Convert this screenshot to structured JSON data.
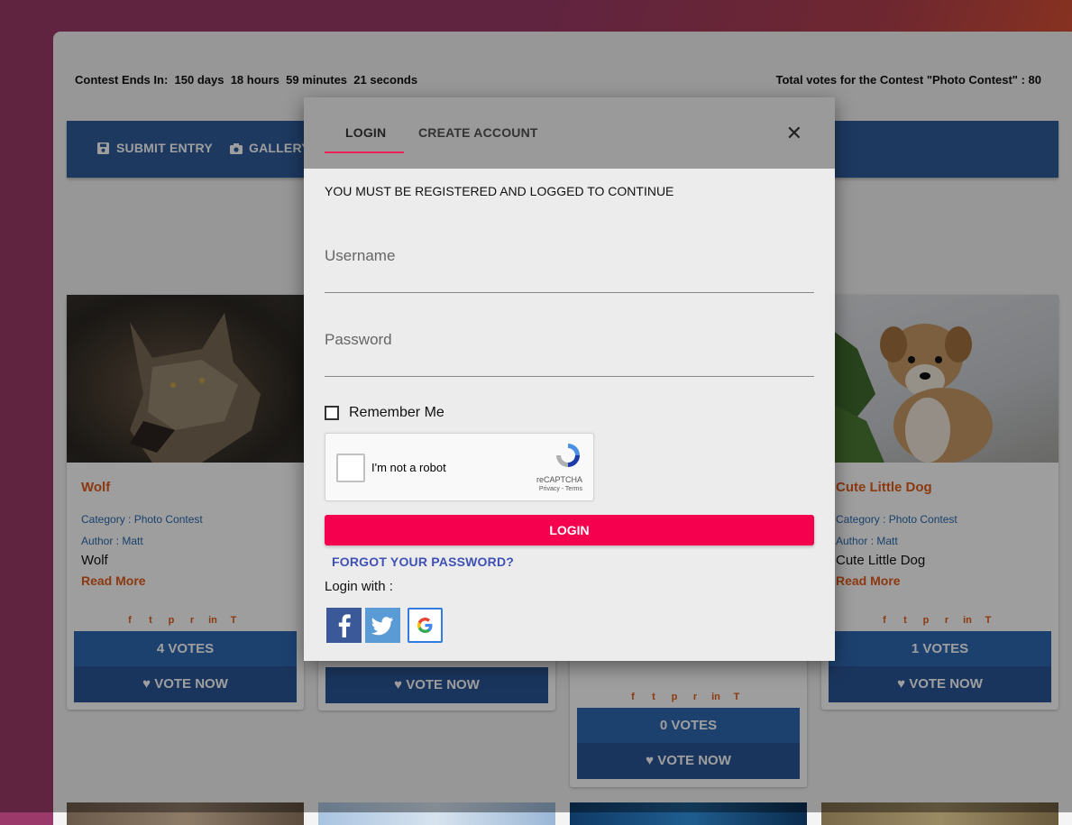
{
  "header": {
    "countdown_label": "Contest Ends In:",
    "days": "150 days",
    "hours": "18 hours",
    "minutes": "59 minutes",
    "seconds": "21 seconds",
    "total_votes": "Total votes for the Contest \"Photo Contest\" : 80"
  },
  "nav": {
    "submit_entry": "SUBMIT ENTRY",
    "gallery": "GALLERY"
  },
  "cards": [
    {
      "title": "Wolf",
      "category": "Category : Photo Contest",
      "author": "Author : Matt",
      "desc": "Wolf",
      "read_more": "Read More",
      "votes": "4 VOTES",
      "vote_btn": "VOTE NOW"
    },
    {
      "votes": "",
      "vote_btn": "VOTE NOW"
    },
    {
      "votes": "0 VOTES",
      "vote_btn": "VOTE NOW"
    },
    {
      "title": "Cute Little Dog",
      "category": "Category : Photo Contest",
      "author": "Author : Matt",
      "desc": "Cute Little Dog",
      "read_more": "Read More",
      "votes": "1 VOTES",
      "vote_btn": "VOTE NOW"
    }
  ],
  "modal": {
    "tab_login": "LOGIN",
    "tab_create": "CREATE ACCOUNT",
    "close": "✕",
    "message": "YOU MUST BE REGISTERED AND LOGGED TO CONTINUE",
    "username_label": "Username",
    "password_label": "Password",
    "remember_label": "Remember Me",
    "captcha_text": "I'm not a robot",
    "captcha_brand": "reCAPTCHA",
    "captcha_terms": "Privacy - Terms",
    "login_button": "LOGIN",
    "forgot": "FORGOT YOUR PASSWORD?",
    "login_with": "Login with :"
  },
  "colors": {
    "accent": "#f5004f",
    "nav": "#2f5d9c",
    "card_title": "#e25c1a",
    "link_blue": "#3f51b5"
  }
}
